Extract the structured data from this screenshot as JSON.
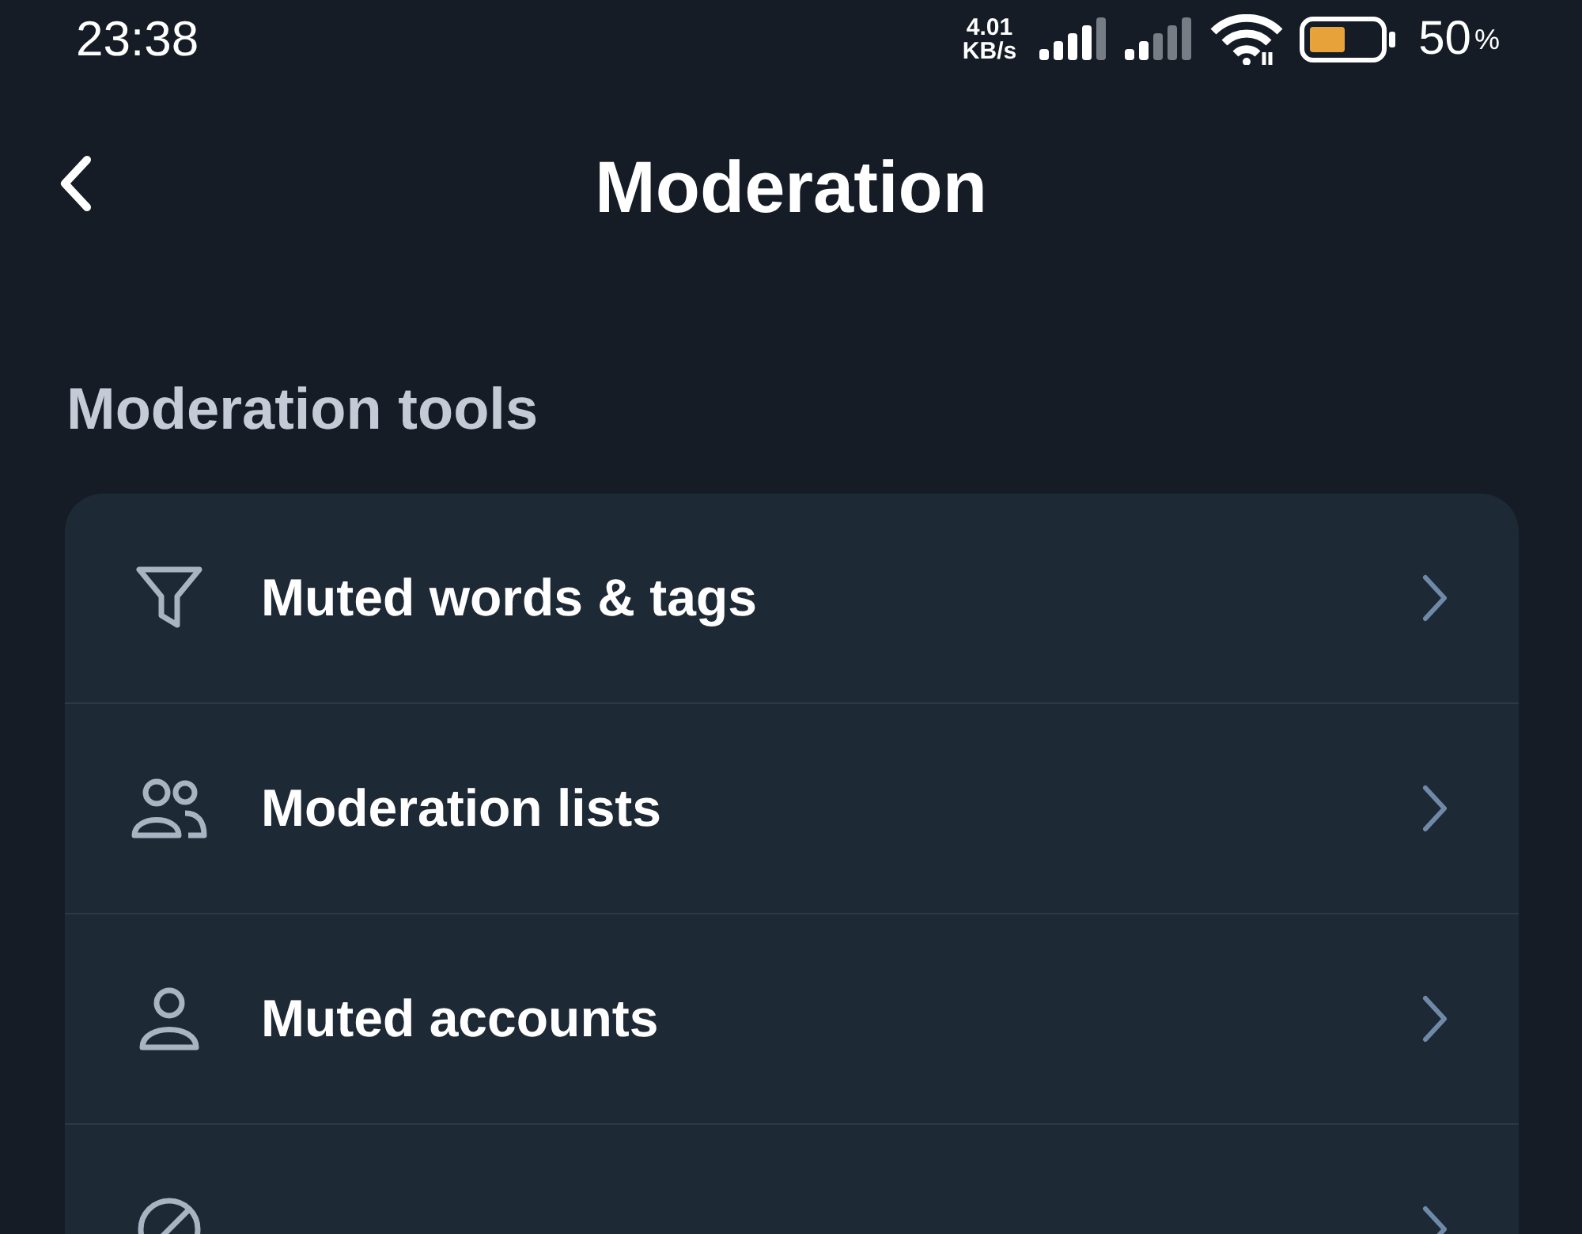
{
  "status_bar": {
    "time": "23:38",
    "speed_value": "4.01",
    "speed_unit": "KB/s",
    "battery_percent": "50",
    "battery_unit": "%"
  },
  "header": {
    "title": "Moderation"
  },
  "section": {
    "title": "Moderation tools"
  },
  "items": [
    {
      "kind": "filter",
      "label": "Muted words & tags"
    },
    {
      "kind": "people",
      "label": "Moderation lists"
    },
    {
      "kind": "person",
      "label": "Muted accounts"
    },
    {
      "kind": "block"
    }
  ]
}
